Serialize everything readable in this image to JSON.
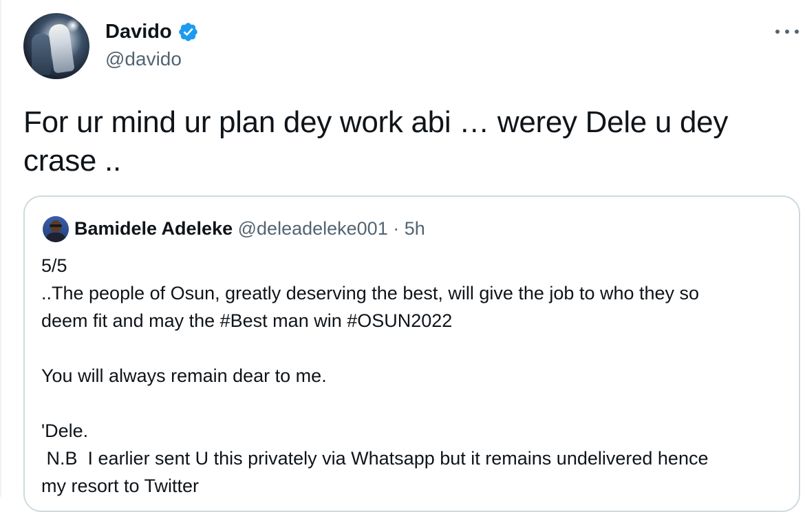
{
  "tweet": {
    "author": {
      "display_name": "Davido",
      "handle": "@davido",
      "verified": true,
      "verified_color": "#1d9bf0"
    },
    "text": "For ur mind ur plan dey work abi … werey Dele u dey crase .."
  },
  "quoted_tweet": {
    "author": {
      "display_name": "Bamidele Adeleke",
      "handle": "@deleadeleke001",
      "separator": "·",
      "time": "5h"
    },
    "lines": [
      "5/5",
      "..The people of Osun, greatly deserving the best, will give the job to who they so",
      "deem fit and may the #Best man win #OSUN2022",
      "",
      "You will always remain dear to me.",
      "",
      "'Dele.",
      " N.B  I earlier sent U this privately via Whatsapp but it remains undelivered hence",
      "my resort to Twitter"
    ]
  },
  "icons": {
    "verified": "verified-badge-icon",
    "more": "more-options-icon"
  },
  "colors": {
    "text_primary": "#0f1419",
    "text_secondary": "#536471",
    "border": "#cfd9de",
    "accent": "#1d9bf0"
  }
}
